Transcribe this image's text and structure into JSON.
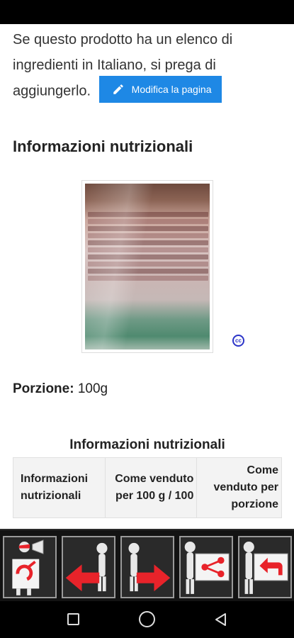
{
  "ingredients": {
    "note": "Se questo prodotto ha un elenco di ingredienti in Italiano, si prega di aggiungerlo.",
    "edit_button": "Modifica la pagina"
  },
  "nutrition": {
    "section_title": "Informazioni nutrizionali",
    "image_license_icon": "creative-commons-icon",
    "portion_label": "Porzione:",
    "portion_value": "100g",
    "table_caption": "Informazioni nutrizionali",
    "table_headers": [
      "Informazioni nutrizionali",
      "Come venduto per 100 g / 100",
      "Come venduto per porzione"
    ]
  },
  "toolbar": {
    "buttons": [
      {
        "icon": "mascot-megaphone-icon"
      },
      {
        "icon": "arrow-left-icon"
      },
      {
        "icon": "arrow-right-icon"
      },
      {
        "icon": "share-icon"
      },
      {
        "icon": "back-icon"
      }
    ],
    "accent_color": "#e8232a"
  },
  "navigation": {
    "icons": [
      "recent-apps-icon",
      "home-icon",
      "back-icon"
    ]
  }
}
